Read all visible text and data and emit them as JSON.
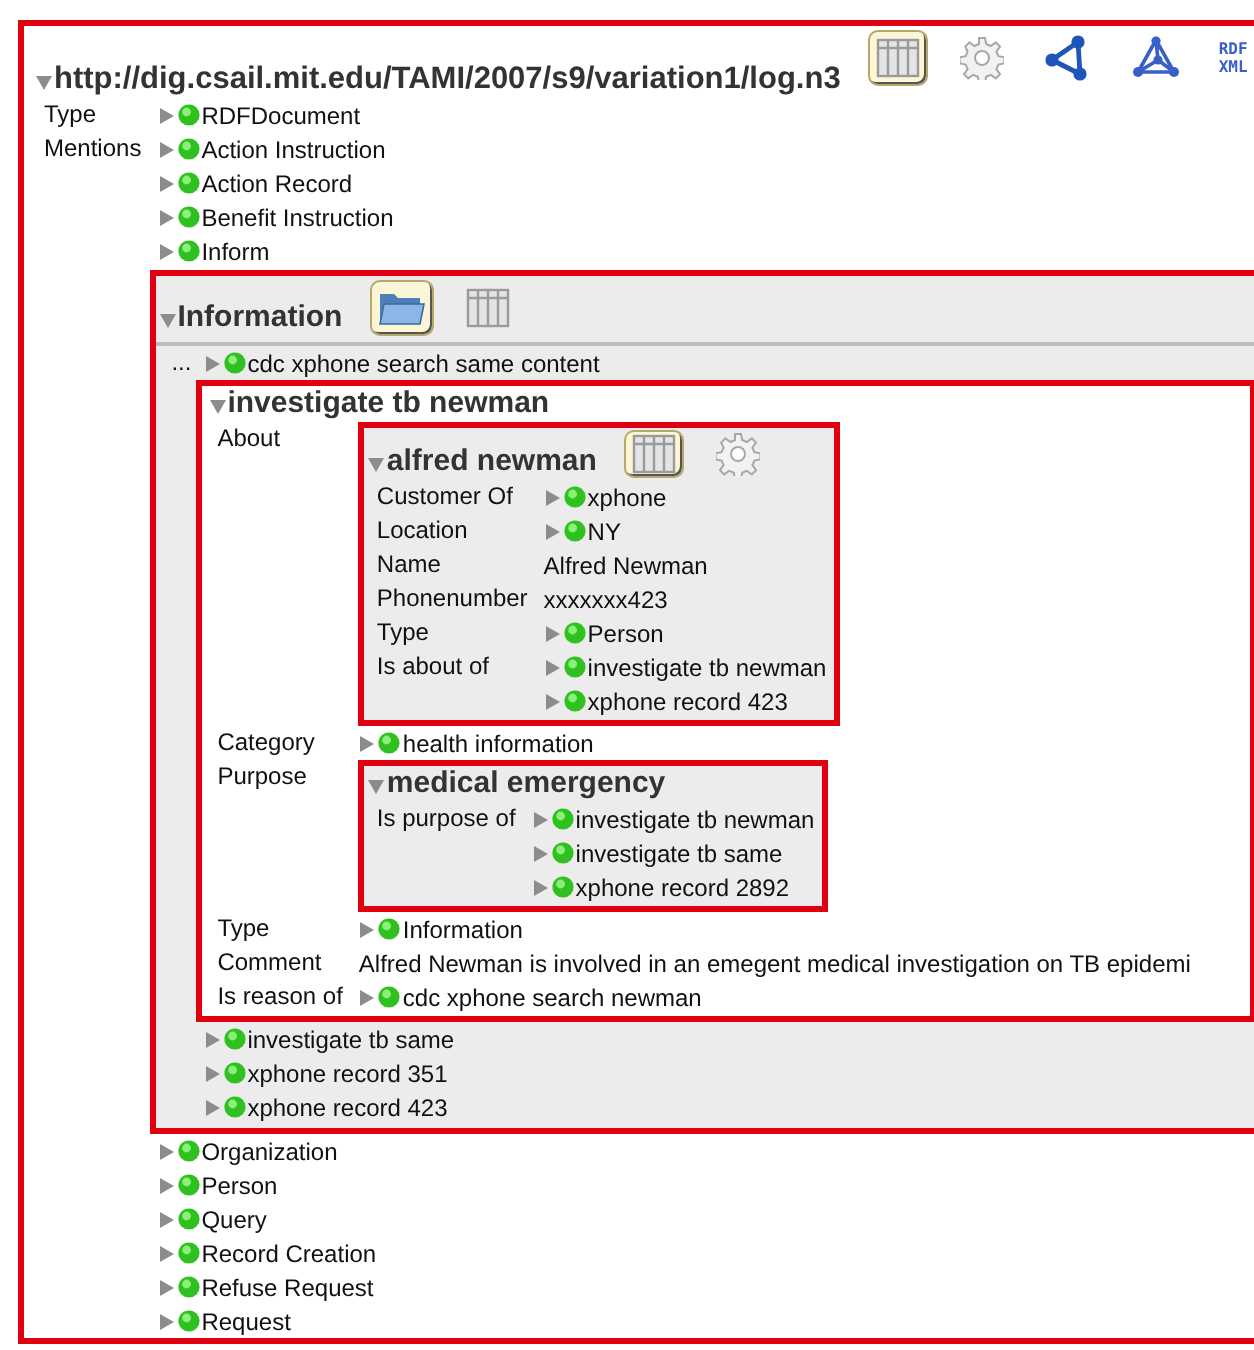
{
  "root": {
    "title": "http://dig.csail.mit.edu/TAMI/2007/s9/variation1/log.n3",
    "toolbar": [
      {
        "kind": "table",
        "selected": true
      },
      {
        "kind": "gear",
        "selected": false
      },
      {
        "kind": "graph",
        "selected": false
      },
      {
        "kind": "graph3d",
        "selected": false
      },
      {
        "kind": "rdf",
        "label_lines": [
          "RDF",
          "XML"
        ],
        "selected": false
      }
    ],
    "properties": [
      {
        "label": "Type",
        "values": [
          {
            "kind": "link",
            "text": "RDFDocument"
          }
        ]
      },
      {
        "label": "Mentions",
        "values": [
          {
            "kind": "link",
            "text": "Action Instruction"
          },
          {
            "kind": "link",
            "text": "Action Record"
          },
          {
            "kind": "link",
            "text": "Benefit Instruction"
          },
          {
            "kind": "link",
            "text": "Inform"
          },
          {
            "kind": "panel",
            "panel": {
              "title": "Information",
              "toolbar": [
                {
                  "kind": "folder",
                  "selected": true
                },
                {
                  "kind": "table",
                  "selected": false
                }
              ],
              "items": [
                {
                  "kind": "link",
                  "marker": "...",
                  "text": "cdc xphone search same content"
                },
                {
                  "kind": "panel",
                  "panel": {
                    "title": "investigate tb newman",
                    "properties": [
                      {
                        "label": "About",
                        "values": [
                          {
                            "kind": "panel",
                            "panel": {
                              "title": "alfred newman",
                              "toolbar": [
                                {
                                  "kind": "table",
                                  "selected": true
                                },
                                {
                                  "kind": "gear",
                                  "selected": false
                                }
                              ],
                              "properties": [
                                {
                                  "label": "Customer Of",
                                  "values": [
                                    {
                                      "kind": "link",
                                      "text": "xphone"
                                    }
                                  ]
                                },
                                {
                                  "label": "Location",
                                  "values": [
                                    {
                                      "kind": "link",
                                      "text": "NY"
                                    }
                                  ]
                                },
                                {
                                  "label": "Name",
                                  "values": [
                                    {
                                      "kind": "literal",
                                      "text": "Alfred Newman"
                                    }
                                  ]
                                },
                                {
                                  "label": "Phonenumber",
                                  "values": [
                                    {
                                      "kind": "literal",
                                      "text": "xxxxxxx423"
                                    }
                                  ]
                                },
                                {
                                  "label": "Type",
                                  "values": [
                                    {
                                      "kind": "link",
                                      "text": "Person"
                                    }
                                  ]
                                },
                                {
                                  "label": "Is about of",
                                  "values": [
                                    {
                                      "kind": "link",
                                      "text": "investigate tb newman"
                                    },
                                    {
                                      "kind": "link",
                                      "text": "xphone record 423"
                                    }
                                  ]
                                }
                              ]
                            }
                          }
                        ]
                      },
                      {
                        "label": "Category",
                        "values": [
                          {
                            "kind": "link",
                            "text": "health information"
                          }
                        ]
                      },
                      {
                        "label": "Purpose",
                        "values": [
                          {
                            "kind": "panel",
                            "panel": {
                              "title": "medical emergency",
                              "properties": [
                                {
                                  "label": "Is purpose of",
                                  "values": [
                                    {
                                      "kind": "link",
                                      "text": "investigate tb newman"
                                    },
                                    {
                                      "kind": "link",
                                      "text": "investigate tb same"
                                    },
                                    {
                                      "kind": "link",
                                      "text": "xphone record 2892"
                                    }
                                  ]
                                }
                              ]
                            }
                          }
                        ]
                      },
                      {
                        "label": "Type",
                        "values": [
                          {
                            "kind": "link",
                            "text": "Information"
                          }
                        ]
                      },
                      {
                        "label": "Comment",
                        "values": [
                          {
                            "kind": "literal",
                            "text": "Alfred Newman is involved in an emegent medical investigation on TB epidemi"
                          }
                        ]
                      },
                      {
                        "label": "Is reason of",
                        "values": [
                          {
                            "kind": "link",
                            "text": "cdc xphone search newman"
                          }
                        ]
                      }
                    ]
                  }
                },
                {
                  "kind": "link",
                  "text": "investigate tb same"
                },
                {
                  "kind": "link",
                  "text": "xphone record 351"
                },
                {
                  "kind": "link",
                  "text": "xphone record 423"
                }
              ]
            }
          },
          {
            "kind": "link",
            "text": "Organization"
          },
          {
            "kind": "link",
            "text": "Person"
          },
          {
            "kind": "link",
            "text": "Query"
          },
          {
            "kind": "link",
            "text": "Record Creation"
          },
          {
            "kind": "link",
            "text": "Refuse Request"
          },
          {
            "kind": "link",
            "text": "Request"
          }
        ]
      }
    ]
  }
}
